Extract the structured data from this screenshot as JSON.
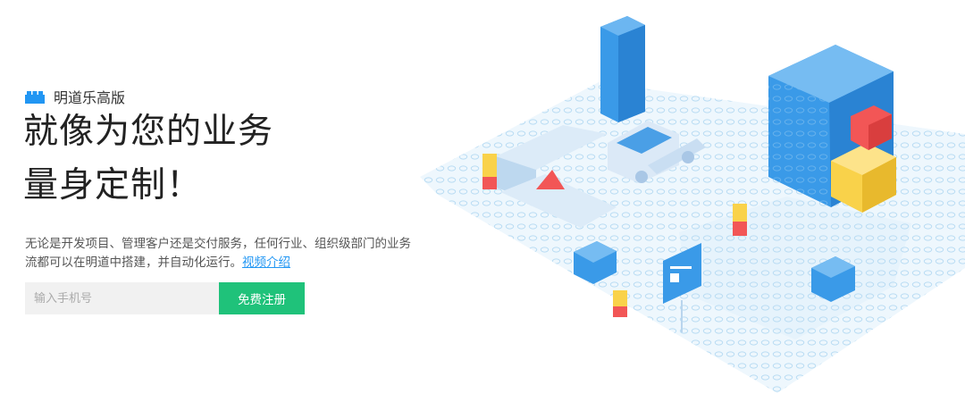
{
  "brand": {
    "logo_icon": "lego-brick-icon",
    "name": "明道乐高版"
  },
  "hero": {
    "headline_line1": "就像为您的业务",
    "headline_line2": "量身定制！",
    "description": "无论是开发项目、管理客户还是交付服务，任何行业、组织级部门的业务流都可以在明道中搭建，并自动化运行。",
    "video_link": "视频介绍"
  },
  "signup": {
    "phone_placeholder": "输入手机号",
    "button_label": "免费注册"
  },
  "colors": {
    "accent_green": "#1fc27a",
    "brand_blue": "#2196f3",
    "block_yellow": "#f9d24a",
    "block_red": "#f25656",
    "plate_blue": "#e3f1fb"
  }
}
